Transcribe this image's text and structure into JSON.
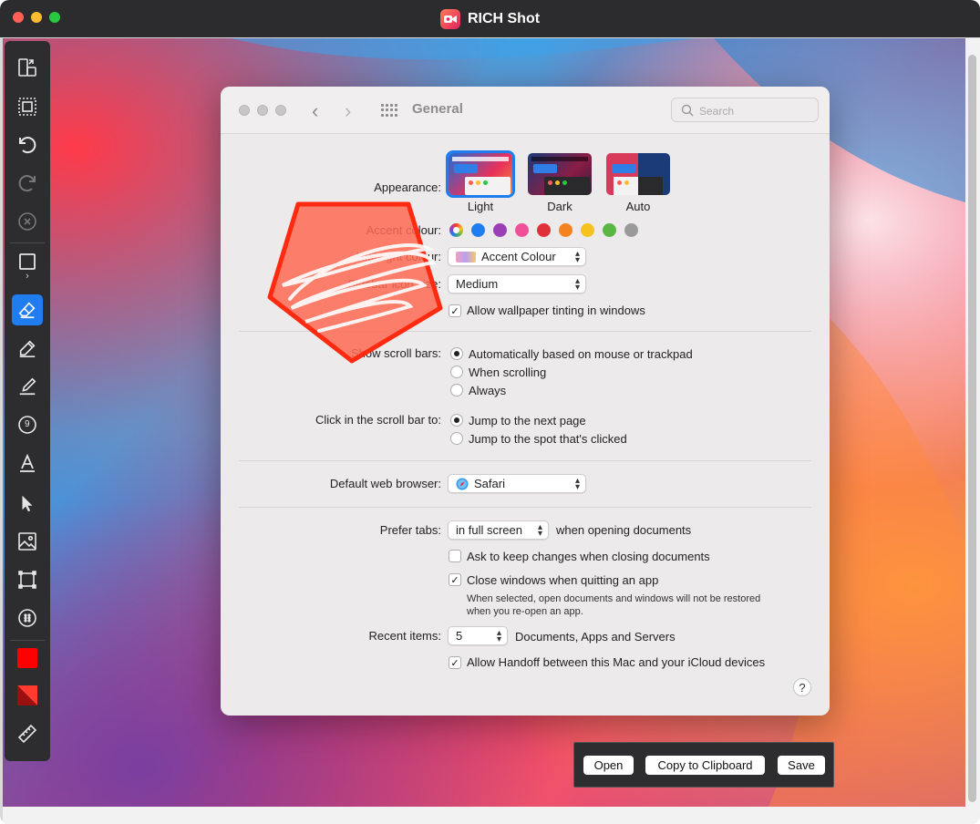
{
  "app": {
    "title": "RICH Shot"
  },
  "prefs": {
    "title": "General",
    "search_placeholder": "Search",
    "appearance": {
      "label": "Appearance:",
      "options": [
        "Light",
        "Dark",
        "Auto"
      ],
      "selected": "Light"
    },
    "accent": {
      "label": "Accent colour:",
      "colors": [
        "#ff3b30",
        "#1f7df0",
        "#9b3fb6",
        "#f0509a",
        "#e0303a",
        "#f58220",
        "#f6c21e",
        "#5ab645",
        "#9a9a9a"
      ]
    },
    "highlight": {
      "label": "Highlight colour:",
      "value": "Accent Colour"
    },
    "sidebar_icon": {
      "label": "Sidebar icon size:",
      "value": "Medium"
    },
    "wallpaper_tint": {
      "label": "Allow wallpaper tinting in windows",
      "checked": true
    },
    "scroll_bars": {
      "label": "Show scroll bars:",
      "options": [
        "Automatically based on mouse or trackpad",
        "When scrolling",
        "Always"
      ],
      "selected": 0
    },
    "click_scroll": {
      "label": "Click in the scroll bar to:",
      "options": [
        "Jump to the next page",
        "Jump to the spot that's clicked"
      ],
      "selected": 0
    },
    "browser": {
      "label": "Default web browser:",
      "value": "Safari"
    },
    "prefer_tabs": {
      "label": "Prefer tabs:",
      "value": "in full screen",
      "suffix": "when opening documents"
    },
    "ask_keep": {
      "label": "Ask to keep changes when closing documents",
      "checked": false
    },
    "close_windows": {
      "label": "Close windows when quitting an app",
      "checked": true,
      "note_line1": "When selected, open documents and windows will not be restored",
      "note_line2": "when you re-open an app."
    },
    "recent": {
      "label": "Recent items:",
      "value": "5",
      "suffix": "Documents, Apps and Servers"
    },
    "handoff": {
      "label": "Allow Handoff between this Mac and your iCloud devices",
      "checked": true
    },
    "help": "?"
  },
  "actions": {
    "open": "Open",
    "copy": "Copy to Clipboard",
    "save": "Save"
  },
  "toolbar": {
    "counter": "9",
    "active_tool": "eraser",
    "color_primary": "#ff0000"
  },
  "annotation": {
    "fill": "#ff6a52",
    "stroke": "#ff2a10"
  }
}
